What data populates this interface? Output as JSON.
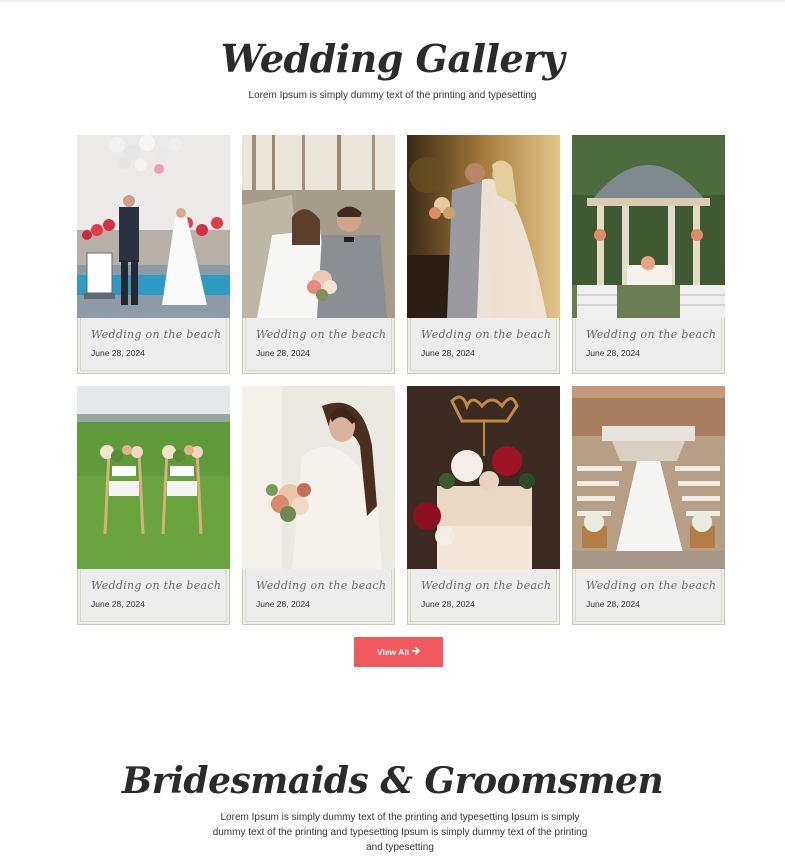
{
  "gallery": {
    "title": "Wedding Gallery",
    "subtitle": "Lorem Ipsum is simply dummy text of the printing and typesetting",
    "cards": [
      {
        "title": "Wedding on the beach",
        "date": "June 28, 2024"
      },
      {
        "title": "Wedding on the beach",
        "date": "June 28, 2024"
      },
      {
        "title": "Wedding on the beach",
        "date": "June 28, 2024"
      },
      {
        "title": "Wedding on the beach",
        "date": "June 28, 2024"
      },
      {
        "title": "Wedding on the beach",
        "date": "June 28, 2024"
      },
      {
        "title": "Wedding on the beach",
        "date": "June 28, 2024"
      },
      {
        "title": "Wedding on the beach",
        "date": "June 28, 2024"
      },
      {
        "title": "Wedding on the beach",
        "date": "June 28, 2024"
      }
    ],
    "view_all_label": "View All",
    "view_all_icon": "arrow-right-icon",
    "button_color": "#f05a5e"
  },
  "bridesmaids": {
    "title": "Bridesmaids & Groomsmen",
    "text": "Lorem Ipsum is simply dummy text of the printing and typesetting Ipsum is simply dummy text of the printing and typesetting Ipsum is simply dummy text of the printing and typesetting"
  }
}
